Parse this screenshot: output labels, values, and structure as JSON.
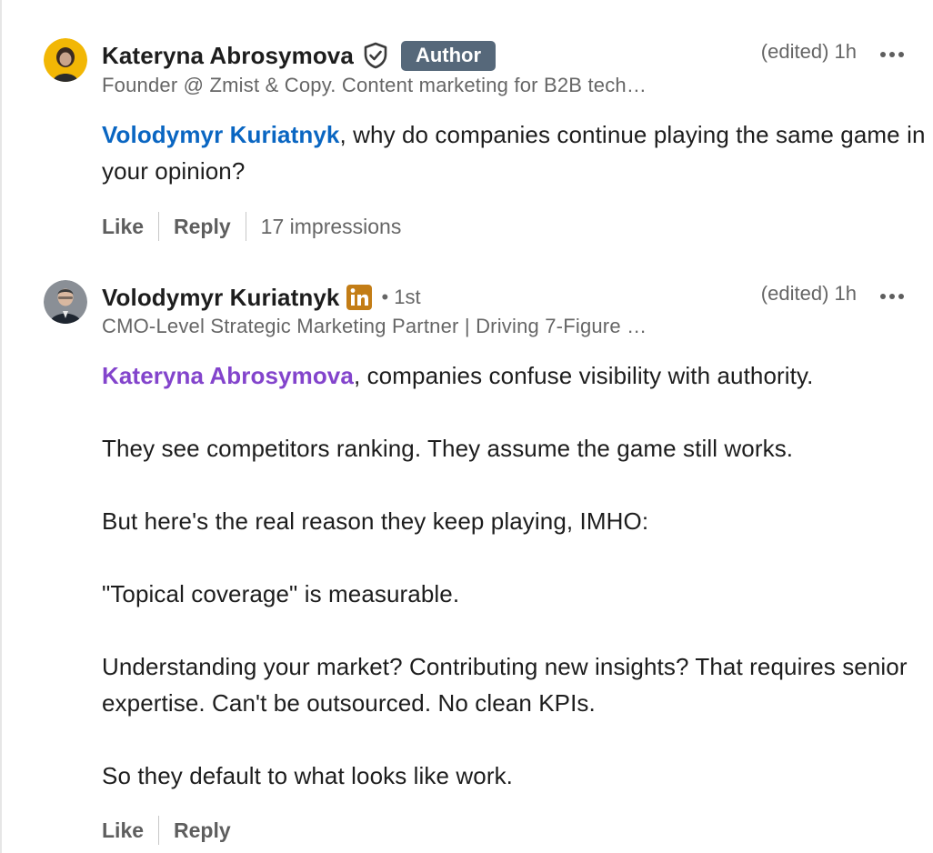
{
  "comments": [
    {
      "author": {
        "name": "Kateryna Abrosymova",
        "badge": "Author",
        "headline": "Founder @ Zmist & Copy. Content marketing for B2B tech…",
        "avatar_icon": "avatar-photo"
      },
      "edited_label": "(edited)",
      "time": "1h",
      "body": {
        "mention": "Volodymyr Kuriatnyk",
        "text": ", why do companies continue playing the same game in your opinion?"
      },
      "actions": {
        "like": "Like",
        "reply": "Reply",
        "impressions": "17 impressions"
      }
    },
    {
      "author": {
        "name": "Volodymyr Kuriatnyk",
        "degree": "• 1st",
        "headline": "CMO-Level Strategic Marketing Partner | Driving 7-Figure …",
        "avatar_icon": "avatar-photo"
      },
      "edited_label": "(edited)",
      "time": "1h",
      "body": {
        "mention": "Kateryna Abrosymova",
        "first_line_rest": ", companies confuse visibility with authority.",
        "paragraphs": [
          "They see competitors ranking. They assume the game still works.",
          "But here's the real reason they keep playing, IMHO:",
          "\"Topical coverage\" is measurable.",
          "Understanding your market? Contributing new insights? That requires senior expertise. Can't be outsourced. No clean KPIs.",
          "So they default to what looks like work."
        ]
      },
      "actions": {
        "like": "Like",
        "reply": "Reply"
      }
    }
  ],
  "colors": {
    "mention_blue": "#0a66c2",
    "mention_purple": "#8344cc",
    "author_badge": "#56687a",
    "linkedin_premium": "#c37d16"
  }
}
